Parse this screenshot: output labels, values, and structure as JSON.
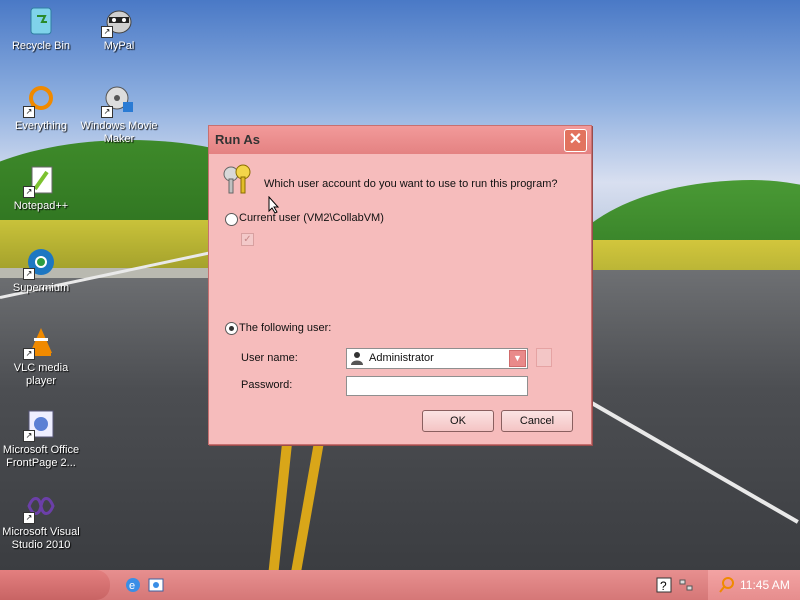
{
  "desktop": {
    "icons": [
      {
        "label": "Recycle Bin",
        "icon": "recycle-bin-icon"
      },
      {
        "label": "MyPal",
        "icon": "mypal-icon"
      },
      {
        "label": "Everything",
        "icon": "everything-icon"
      },
      {
        "label": "Windows Movie Maker",
        "icon": "movie-maker-icon"
      },
      {
        "label": "Notepad++",
        "icon": "notepad-plus-plus-icon"
      },
      {
        "label": "Supermium",
        "icon": "supermium-icon"
      },
      {
        "label": "VLC media player",
        "icon": "vlc-icon"
      },
      {
        "label": "Microsoft Office FrontPage 2...",
        "icon": "frontpage-icon"
      },
      {
        "label": "Microsoft Visual Studio 2010",
        "icon": "visual-studio-icon"
      }
    ]
  },
  "dialog": {
    "title": "Run As",
    "prompt": "Which user account do you want to use to run this program?",
    "current_user_label": "Current user (VM2\\CollabVM)",
    "current_user_selected": false,
    "following_user_label": "The following user:",
    "following_user_selected": true,
    "username_label": "User name:",
    "username_value": "Administrator",
    "password_label": "Password:",
    "password_value": "",
    "ok_label": "OK",
    "cancel_label": "Cancel"
  },
  "taskbar": {
    "clock": "11:45 AM"
  },
  "colors": {
    "dialog_bg": "#f6bcbc",
    "titlebar": "#e48282",
    "taskbar": "#d57777"
  }
}
